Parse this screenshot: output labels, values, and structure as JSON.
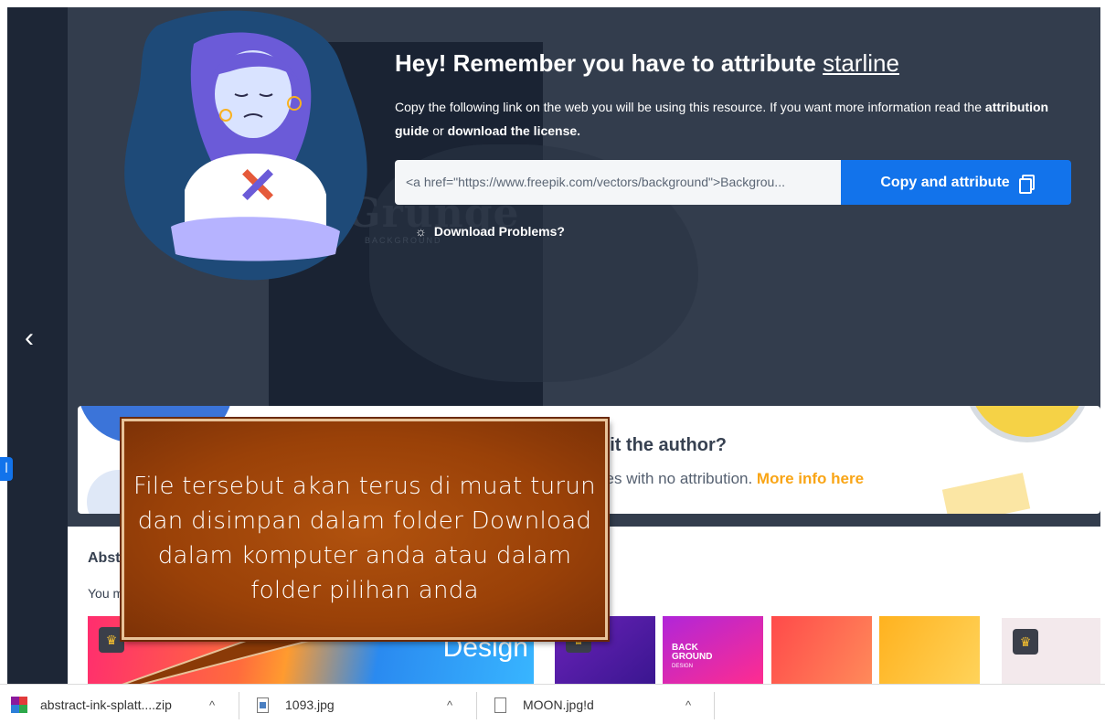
{
  "attribution": {
    "title_prefix": "Hey! Remember you have to attribute ",
    "author": "starline",
    "desc_1": "Copy the following link on the web you will be using this resource. If you want more information read the ",
    "guide_link": "attribution guide",
    "desc_or": " or ",
    "license_link": "download the license.",
    "link_value": "<a href=\"https://www.freepik.com/vectors/background\">Backgrou...",
    "copy_button": "Copy and attribute",
    "download_problems": "Download Problems?"
  },
  "background_image": {
    "word": "Grunge",
    "sub": "BACKGROUND"
  },
  "credit_banner": {
    "title": "dit the author?",
    "text": "iles with no attribution. ",
    "more_link": "More info here"
  },
  "lower": {
    "heading": "Abstr",
    "subtext": "You m",
    "thumb1_text": "Design",
    "thumb3_text_1": "BACK",
    "thumb3_text_2": "GROUND",
    "thumb3_text_3": "DESIGN"
  },
  "callout": {
    "text": "File tersebut akan terus di muat turun dan disimpan dalam folder Download dalam komputer anda atau dalam folder pilihan anda"
  },
  "downloads": [
    {
      "name": "abstract-ink-splatt....zip",
      "icon": "archive-icon"
    },
    {
      "name": "1093.jpg",
      "icon": "image-file-icon"
    },
    {
      "name": "MOON.jpg!d",
      "icon": "file-icon"
    }
  ],
  "colors": {
    "accent": "#1273eb",
    "dark_bg": "#333d4d",
    "callout": "#9a4108",
    "more_link": "#f9a516"
  }
}
